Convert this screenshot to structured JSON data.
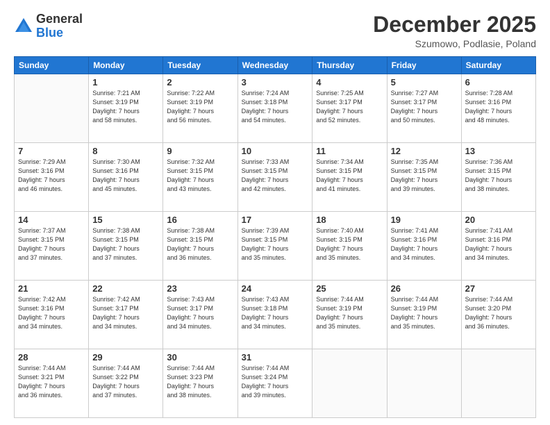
{
  "logo": {
    "general": "General",
    "blue": "Blue"
  },
  "header": {
    "month": "December 2025",
    "location": "Szumowo, Podlasie, Poland"
  },
  "weekdays": [
    "Sunday",
    "Monday",
    "Tuesday",
    "Wednesday",
    "Thursday",
    "Friday",
    "Saturday"
  ],
  "weeks": [
    [
      {
        "date": "",
        "info": ""
      },
      {
        "date": "1",
        "info": "Sunrise: 7:21 AM\nSunset: 3:19 PM\nDaylight: 7 hours\nand 58 minutes."
      },
      {
        "date": "2",
        "info": "Sunrise: 7:22 AM\nSunset: 3:19 PM\nDaylight: 7 hours\nand 56 minutes."
      },
      {
        "date": "3",
        "info": "Sunrise: 7:24 AM\nSunset: 3:18 PM\nDaylight: 7 hours\nand 54 minutes."
      },
      {
        "date": "4",
        "info": "Sunrise: 7:25 AM\nSunset: 3:17 PM\nDaylight: 7 hours\nand 52 minutes."
      },
      {
        "date": "5",
        "info": "Sunrise: 7:27 AM\nSunset: 3:17 PM\nDaylight: 7 hours\nand 50 minutes."
      },
      {
        "date": "6",
        "info": "Sunrise: 7:28 AM\nSunset: 3:16 PM\nDaylight: 7 hours\nand 48 minutes."
      }
    ],
    [
      {
        "date": "7",
        "info": "Sunrise: 7:29 AM\nSunset: 3:16 PM\nDaylight: 7 hours\nand 46 minutes."
      },
      {
        "date": "8",
        "info": "Sunrise: 7:30 AM\nSunset: 3:16 PM\nDaylight: 7 hours\nand 45 minutes."
      },
      {
        "date": "9",
        "info": "Sunrise: 7:32 AM\nSunset: 3:15 PM\nDaylight: 7 hours\nand 43 minutes."
      },
      {
        "date": "10",
        "info": "Sunrise: 7:33 AM\nSunset: 3:15 PM\nDaylight: 7 hours\nand 42 minutes."
      },
      {
        "date": "11",
        "info": "Sunrise: 7:34 AM\nSunset: 3:15 PM\nDaylight: 7 hours\nand 41 minutes."
      },
      {
        "date": "12",
        "info": "Sunrise: 7:35 AM\nSunset: 3:15 PM\nDaylight: 7 hours\nand 39 minutes."
      },
      {
        "date": "13",
        "info": "Sunrise: 7:36 AM\nSunset: 3:15 PM\nDaylight: 7 hours\nand 38 minutes."
      }
    ],
    [
      {
        "date": "14",
        "info": "Sunrise: 7:37 AM\nSunset: 3:15 PM\nDaylight: 7 hours\nand 37 minutes."
      },
      {
        "date": "15",
        "info": "Sunrise: 7:38 AM\nSunset: 3:15 PM\nDaylight: 7 hours\nand 37 minutes."
      },
      {
        "date": "16",
        "info": "Sunrise: 7:38 AM\nSunset: 3:15 PM\nDaylight: 7 hours\nand 36 minutes."
      },
      {
        "date": "17",
        "info": "Sunrise: 7:39 AM\nSunset: 3:15 PM\nDaylight: 7 hours\nand 35 minutes."
      },
      {
        "date": "18",
        "info": "Sunrise: 7:40 AM\nSunset: 3:15 PM\nDaylight: 7 hours\nand 35 minutes."
      },
      {
        "date": "19",
        "info": "Sunrise: 7:41 AM\nSunset: 3:16 PM\nDaylight: 7 hours\nand 34 minutes."
      },
      {
        "date": "20",
        "info": "Sunrise: 7:41 AM\nSunset: 3:16 PM\nDaylight: 7 hours\nand 34 minutes."
      }
    ],
    [
      {
        "date": "21",
        "info": "Sunrise: 7:42 AM\nSunset: 3:16 PM\nDaylight: 7 hours\nand 34 minutes."
      },
      {
        "date": "22",
        "info": "Sunrise: 7:42 AM\nSunset: 3:17 PM\nDaylight: 7 hours\nand 34 minutes."
      },
      {
        "date": "23",
        "info": "Sunrise: 7:43 AM\nSunset: 3:17 PM\nDaylight: 7 hours\nand 34 minutes."
      },
      {
        "date": "24",
        "info": "Sunrise: 7:43 AM\nSunset: 3:18 PM\nDaylight: 7 hours\nand 34 minutes."
      },
      {
        "date": "25",
        "info": "Sunrise: 7:44 AM\nSunset: 3:19 PM\nDaylight: 7 hours\nand 35 minutes."
      },
      {
        "date": "26",
        "info": "Sunrise: 7:44 AM\nSunset: 3:19 PM\nDaylight: 7 hours\nand 35 minutes."
      },
      {
        "date": "27",
        "info": "Sunrise: 7:44 AM\nSunset: 3:20 PM\nDaylight: 7 hours\nand 36 minutes."
      }
    ],
    [
      {
        "date": "28",
        "info": "Sunrise: 7:44 AM\nSunset: 3:21 PM\nDaylight: 7 hours\nand 36 minutes."
      },
      {
        "date": "29",
        "info": "Sunrise: 7:44 AM\nSunset: 3:22 PM\nDaylight: 7 hours\nand 37 minutes."
      },
      {
        "date": "30",
        "info": "Sunrise: 7:44 AM\nSunset: 3:23 PM\nDaylight: 7 hours\nand 38 minutes."
      },
      {
        "date": "31",
        "info": "Sunrise: 7:44 AM\nSunset: 3:24 PM\nDaylight: 7 hours\nand 39 minutes."
      },
      {
        "date": "",
        "info": ""
      },
      {
        "date": "",
        "info": ""
      },
      {
        "date": "",
        "info": ""
      }
    ]
  ]
}
